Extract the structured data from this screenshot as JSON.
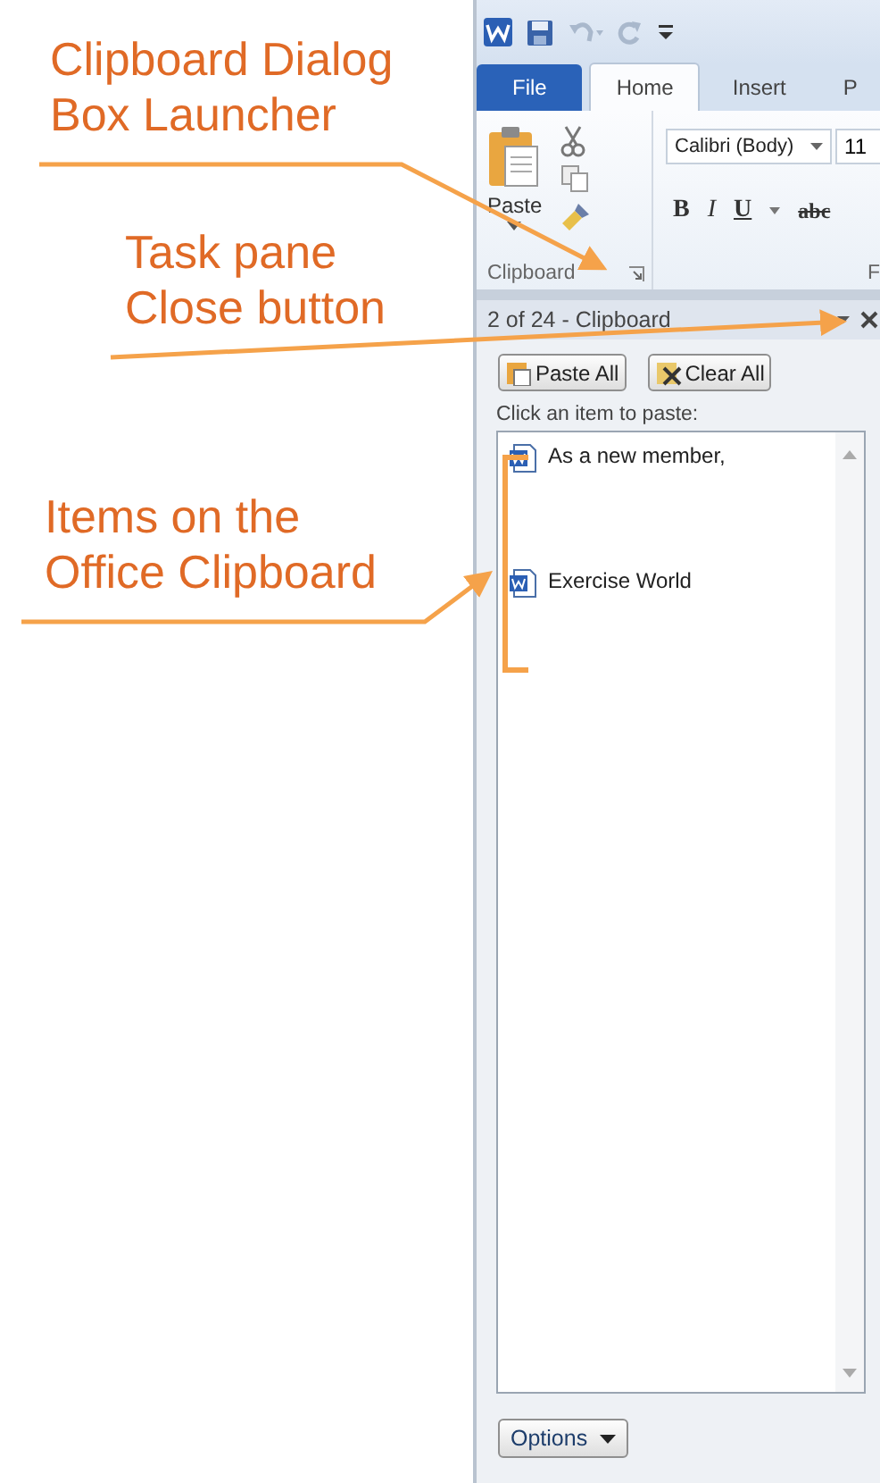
{
  "callouts": [
    {
      "lines": [
        "Clipboard Dialog",
        "Box Launcher"
      ]
    },
    {
      "lines": [
        "Task pane",
        "Close button"
      ]
    },
    {
      "lines": [
        "Items on the",
        "Office Clipboard"
      ]
    }
  ],
  "ribbon_tabs": [
    {
      "label": "File",
      "kind": "file",
      "selected": false
    },
    {
      "label": "Home",
      "kind": "tab",
      "selected": true
    },
    {
      "label": "Insert",
      "kind": "tab",
      "selected": false
    },
    {
      "label": "P",
      "kind": "tab",
      "selected": false
    }
  ],
  "clipboard_group": {
    "paste_label": "Paste",
    "group_label": "Clipboard"
  },
  "font_group": {
    "font": "Calibri (Body)",
    "size": "11",
    "group_label": "F",
    "format_buttons": [
      {
        "label": "B",
        "kind": "bold"
      },
      {
        "label": "I",
        "kind": "italic"
      },
      {
        "label": "U",
        "kind": "underline"
      },
      {
        "label": "abc",
        "kind": "strike"
      }
    ]
  },
  "task_pane": {
    "title": "2 of 24 - Clipboard",
    "buttons": [
      "Paste All",
      "Clear All"
    ],
    "prompt": "Click an item to paste:",
    "items": [
      "As a new member,",
      "Exercise World"
    ],
    "options_label": "Options"
  }
}
